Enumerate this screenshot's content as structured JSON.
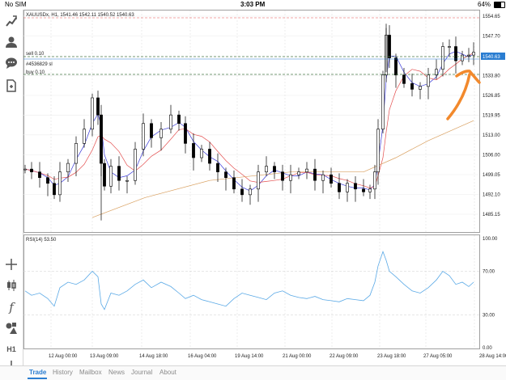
{
  "status_bar": {
    "carrier": "No SIM",
    "time": "3:03 PM",
    "battery": "64%"
  },
  "chart_header": {
    "symbol_line": "XAUUSDx, H1, 1541.46 1542.11 1540.52 1540.63"
  },
  "order_lines": {
    "sell_label": "sell 0.10",
    "sl_label": "#4536829 sl",
    "buy_label": "buy 0.10"
  },
  "current_price": "1540.63",
  "price_axis": [
    "1554.65",
    "1547.70",
    "1533.80",
    "1526.85",
    "1519.95",
    "1513.00",
    "1506.00",
    "1499.05",
    "1492.10",
    "1485.15"
  ],
  "rsi": {
    "label": "RSI(14) 53.50",
    "axis": [
      "100.00",
      "70.00",
      "30.00",
      "0.00"
    ]
  },
  "time_axis": [
    "12 Aug 00:00",
    "13 Aug 09:00",
    "14 Aug 18:00",
    "16 Aug 04:00",
    "19 Aug 14:00",
    "21 Aug 00:00",
    "22 Aug 09:00",
    "23 Aug 18:00",
    "27 Aug 05:00",
    "28 Aug 14:00"
  ],
  "left_toolbar": [
    {
      "icon": "chart-plus-icon"
    },
    {
      "icon": "user-icon"
    },
    {
      "icon": "chat-icon"
    },
    {
      "icon": "document-icon"
    },
    {
      "icon": "crosshair-icon"
    },
    {
      "icon": "candlestick-icon"
    },
    {
      "icon": "function-icon"
    },
    {
      "icon": "shapes-icon"
    },
    {
      "icon": "timeframe-icon",
      "label": "H1"
    },
    {
      "icon": "plus-icon"
    }
  ],
  "bottom_tabs": [
    {
      "label": "Trade",
      "active": true
    },
    {
      "label": "History",
      "active": false
    },
    {
      "label": "Mailbox",
      "active": false
    },
    {
      "label": "News",
      "active": false
    },
    {
      "label": "Journal",
      "active": false
    },
    {
      "label": "About",
      "active": false
    }
  ],
  "colors": {
    "price_label_bg": "#2a7dd1",
    "ma_fast": "#3a3ad8",
    "ma_mid": "#e45050",
    "ma_slow": "#d9a060",
    "rsi_line": "#5aa9e6",
    "annotation": "#f2892c",
    "order_line": "#4a7a4a"
  }
}
